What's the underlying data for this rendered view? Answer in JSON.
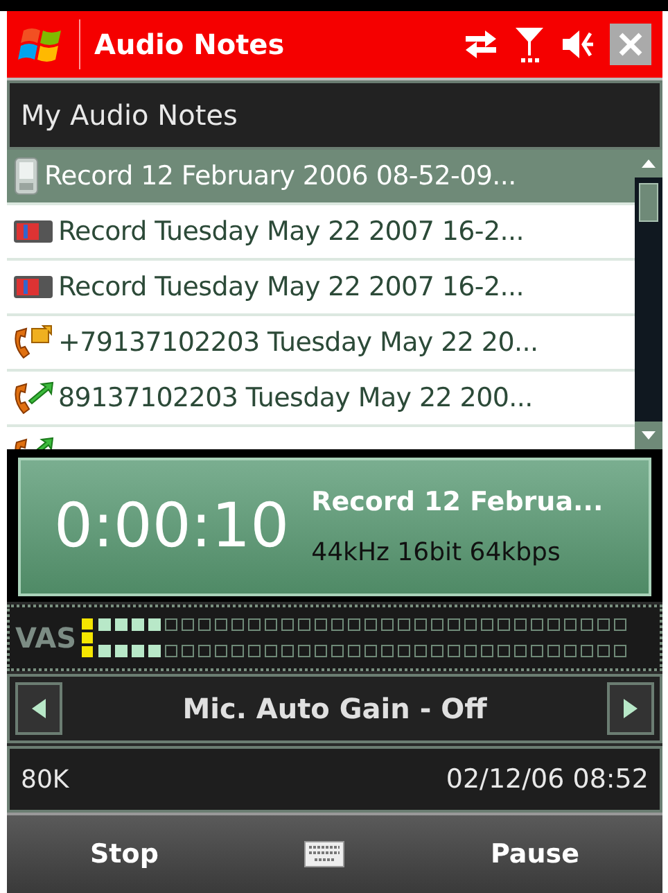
{
  "title_bar": {
    "title": "Audio Notes"
  },
  "folder": {
    "title": "My Audio Notes"
  },
  "notes": [
    {
      "kind": "device",
      "label": "Record 12 February 2006 08-52-09...",
      "selected": true
    },
    {
      "kind": "record",
      "label": "Record Tuesday May 22 2007 16-2...",
      "selected": false
    },
    {
      "kind": "record",
      "label": "Record Tuesday May 22 2007 16-2...",
      "selected": false
    },
    {
      "kind": "incoming-call",
      "label": "+79137102203 Tuesday May 22 20...",
      "selected": false
    },
    {
      "kind": "outgoing-call",
      "label": "89137102203 Tuesday May 22 200...",
      "selected": false
    },
    {
      "kind": "received-call",
      "selected": false
    }
  ],
  "player": {
    "time": "0:00:10",
    "track": "Record 12 Februa...",
    "format": "44kHz 16bit 64kbps"
  },
  "meter": {
    "label": "VAS",
    "vas_on": true,
    "channels": [
      {
        "level": 0.12
      },
      {
        "level": 0.12
      }
    ]
  },
  "gain": {
    "label": "Mic. Auto Gain - Off"
  },
  "info": {
    "size": "80K",
    "date": "02/12/06 08:52"
  },
  "softkeys": {
    "left": "Stop",
    "right": "Pause"
  }
}
